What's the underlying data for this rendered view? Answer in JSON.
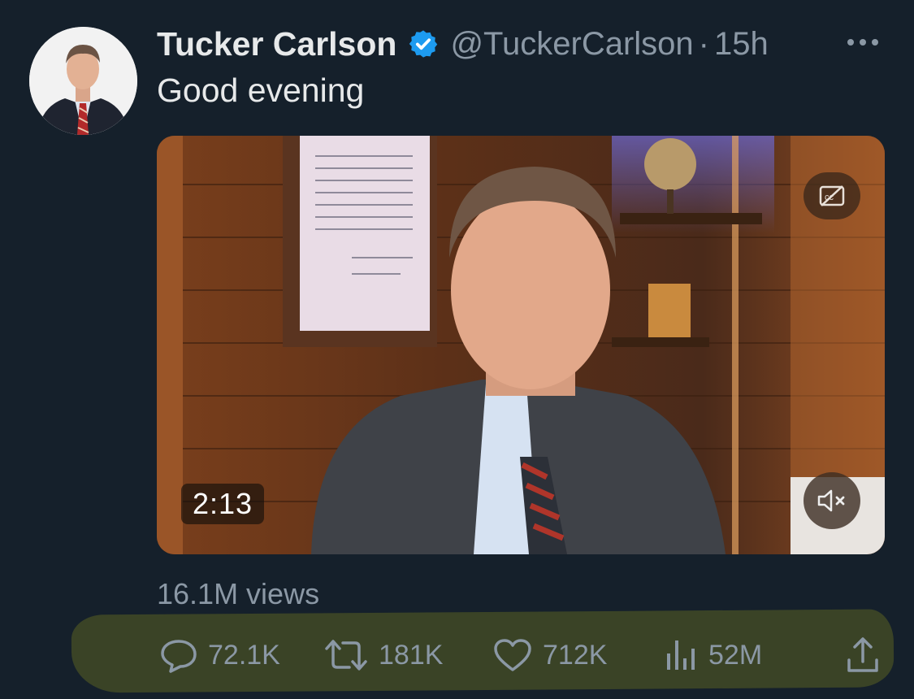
{
  "tweet": {
    "author_name": "Tucker Carlson",
    "handle": "@TuckerCarlson",
    "separator": "·",
    "time": "15h",
    "text": "Good evening",
    "video_duration": "2:13",
    "views": "16.1M views"
  },
  "actions": {
    "replies": "72.1K",
    "retweets": "181K",
    "likes": "712K",
    "views": "52M"
  },
  "icons": [
    "verified-badge-icon",
    "more-options-icon",
    "closed-captions-off-icon",
    "muted-speaker-icon",
    "reply-icon",
    "retweet-icon",
    "like-icon",
    "views-chart-icon",
    "share-icon"
  ],
  "colors": {
    "background": "#15202b",
    "verified": "#1d9bf0",
    "secondary_text": "#8b98a5",
    "highlight": "#3c4626"
  }
}
